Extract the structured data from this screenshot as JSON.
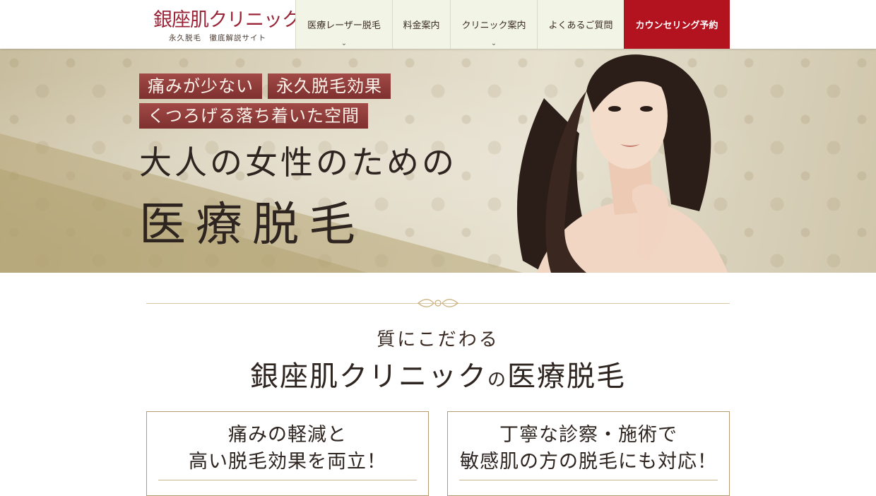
{
  "header": {
    "logo_main": "銀座肌クリニック",
    "logo_sub": "永久脱毛　徹底解説サイト",
    "nav": [
      {
        "label": "医療レーザー脱毛",
        "has_dropdown": true
      },
      {
        "label": "料金案内",
        "has_dropdown": false
      },
      {
        "label": "クリニック案内",
        "has_dropdown": true
      },
      {
        "label": "よくあるご質問",
        "has_dropdown": false
      }
    ],
    "cta_label": "カウンセリング予約"
  },
  "hero": {
    "tags_row1": [
      "痛みが少ない",
      "永久脱毛効果"
    ],
    "tags_row2": [
      "くつろげる落ち着いた空間"
    ],
    "line1": "大人の女性のための",
    "line2": "医療脱毛"
  },
  "section": {
    "subtitle": "質にこだわる",
    "title_part1": "銀座肌クリニック",
    "title_part2": "の",
    "title_part3": "医療脱毛",
    "cards": [
      {
        "line1": "痛みの軽減と",
        "line2": "高い脱毛効果を両立！"
      },
      {
        "line1": "丁寧な診察・施術で",
        "line2": "敏感肌の方の脱毛にも対応！"
      }
    ]
  },
  "colors": {
    "brand_red": "#b3121f",
    "logo_red": "#9b2538",
    "nav_bg": "#f2f5e6",
    "tag_bg": "#8c3a3a",
    "gold_line": "#d9c7a6"
  }
}
